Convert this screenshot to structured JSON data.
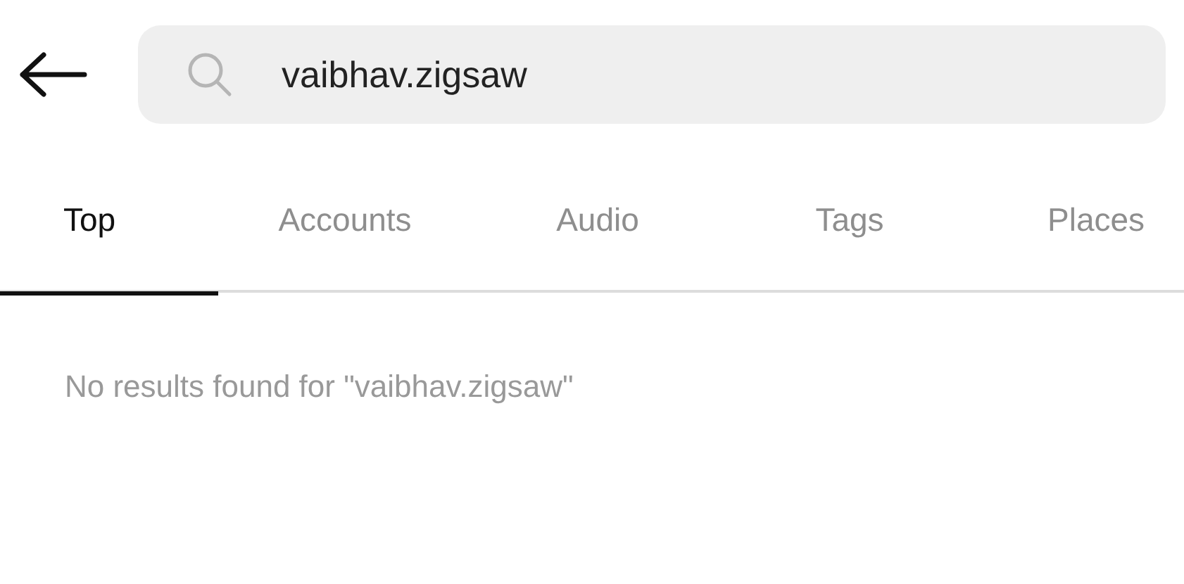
{
  "search": {
    "value": "vaibhav.zigsaw"
  },
  "tabs": [
    {
      "label": "Top",
      "selected": true
    },
    {
      "label": "Accounts",
      "selected": false
    },
    {
      "label": "Audio",
      "selected": false
    },
    {
      "label": "Tags",
      "selected": false
    },
    {
      "label": "Places",
      "selected": false
    }
  ],
  "message": "No results found for \"vaibhav.zigsaw\""
}
